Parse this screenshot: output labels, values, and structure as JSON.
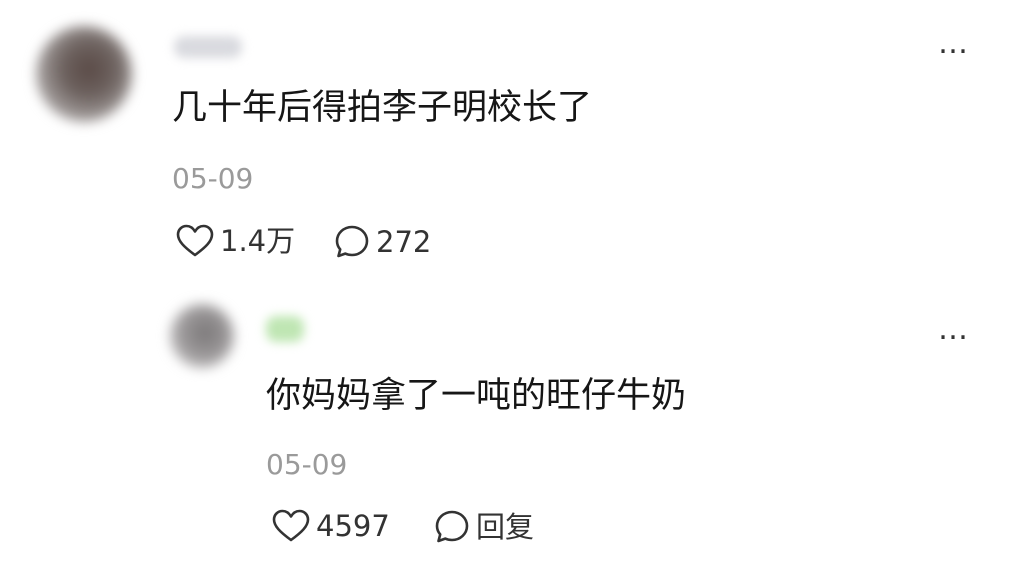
{
  "comment": {
    "text": "几十年后得拍李子明校长了",
    "date": "05-09",
    "likes": "1.4万",
    "comments": "272",
    "more_icon": "…"
  },
  "reply": {
    "text": "你妈妈拿了一吨的旺仔牛奶",
    "date": "05-09",
    "likes": "4597",
    "reply_label": "回复",
    "more_icon": "…"
  },
  "colors": {
    "text": "#161616",
    "meta": "#9a9a9a",
    "icon": "#333333"
  }
}
